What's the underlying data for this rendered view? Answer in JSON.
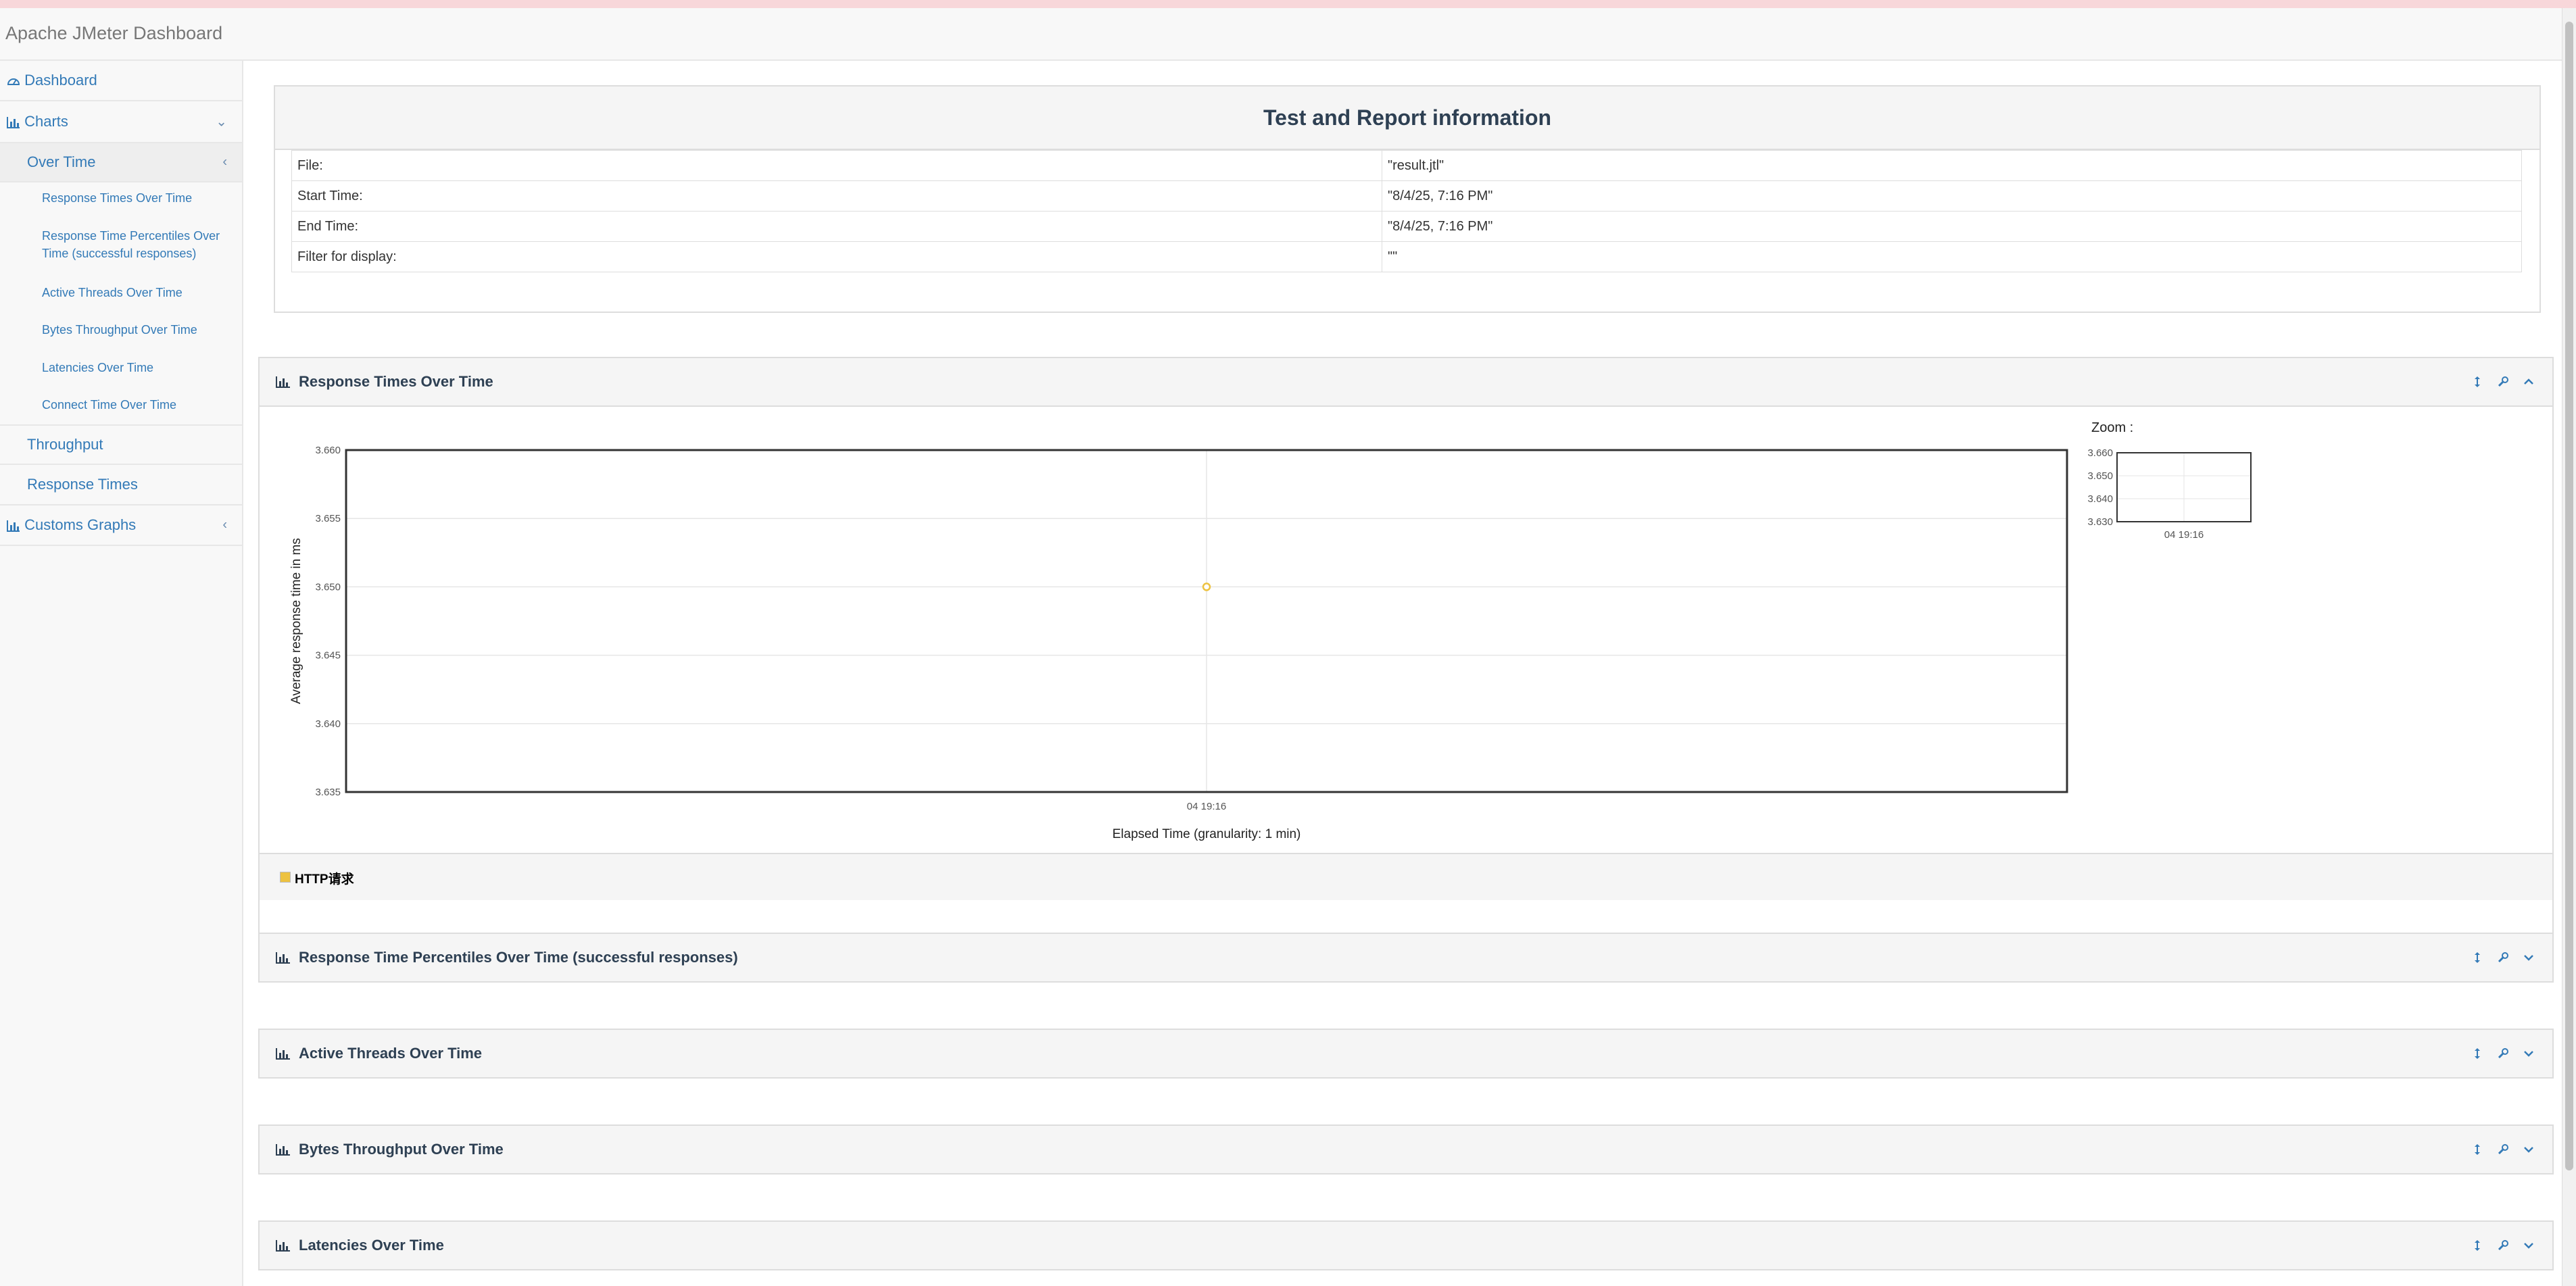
{
  "app": {
    "title": "Apache JMeter Dashboard"
  },
  "sidebar": {
    "dashboard": "Dashboard",
    "charts": "Charts",
    "over_time": "Over Time",
    "sub_items": [
      "Response Times Over Time",
      "Response Time Percentiles Over",
      "Time (successful responses)",
      "Active Threads Over Time",
      "Bytes Throughput Over Time",
      "Latencies Over Time",
      "Connect Time Over Time"
    ],
    "throughput": "Throughput",
    "response_times": "Response Times",
    "customs_graphs": "Customs Graphs"
  },
  "info": {
    "title": "Test and Report information",
    "rows": [
      {
        "label": "File:",
        "value": "\"result.jtl\""
      },
      {
        "label": "Start Time:",
        "value": "\"8/4/25, 7:16 PM\""
      },
      {
        "label": "End Time:",
        "value": "\"8/4/25, 7:16 PM\""
      },
      {
        "label": "Filter for display:",
        "value": "\"\""
      }
    ]
  },
  "panels": [
    "Response Times Over Time",
    "Response Time Percentiles Over Time (successful responses)",
    "Active Threads Over Time",
    "Bytes Throughput Over Time",
    "Latencies Over Time"
  ],
  "zoom_label": "Zoom :",
  "legend": {
    "label": "HTTP请求",
    "color": "#edc240"
  },
  "chart_data": {
    "type": "line",
    "xlabel": "Elapsed Time (granularity: 1 min)",
    "ylabel": "Average response time in ms",
    "x": [
      "04 19:16"
    ],
    "ylim": [
      3.635,
      3.66
    ],
    "yticks": [
      "3.660",
      "3.655",
      "3.650",
      "3.645",
      "3.640",
      "3.635"
    ],
    "series": [
      {
        "name": "HTTP请求",
        "values": [
          3.65
        ],
        "color": "#edc240"
      }
    ],
    "zoom": {
      "ylim": [
        3.63,
        3.66
      ],
      "yticks": [
        "3.660",
        "3.650",
        "3.640",
        "3.630"
      ],
      "xticks": [
        "04 19:16"
      ]
    },
    "grid": true
  }
}
